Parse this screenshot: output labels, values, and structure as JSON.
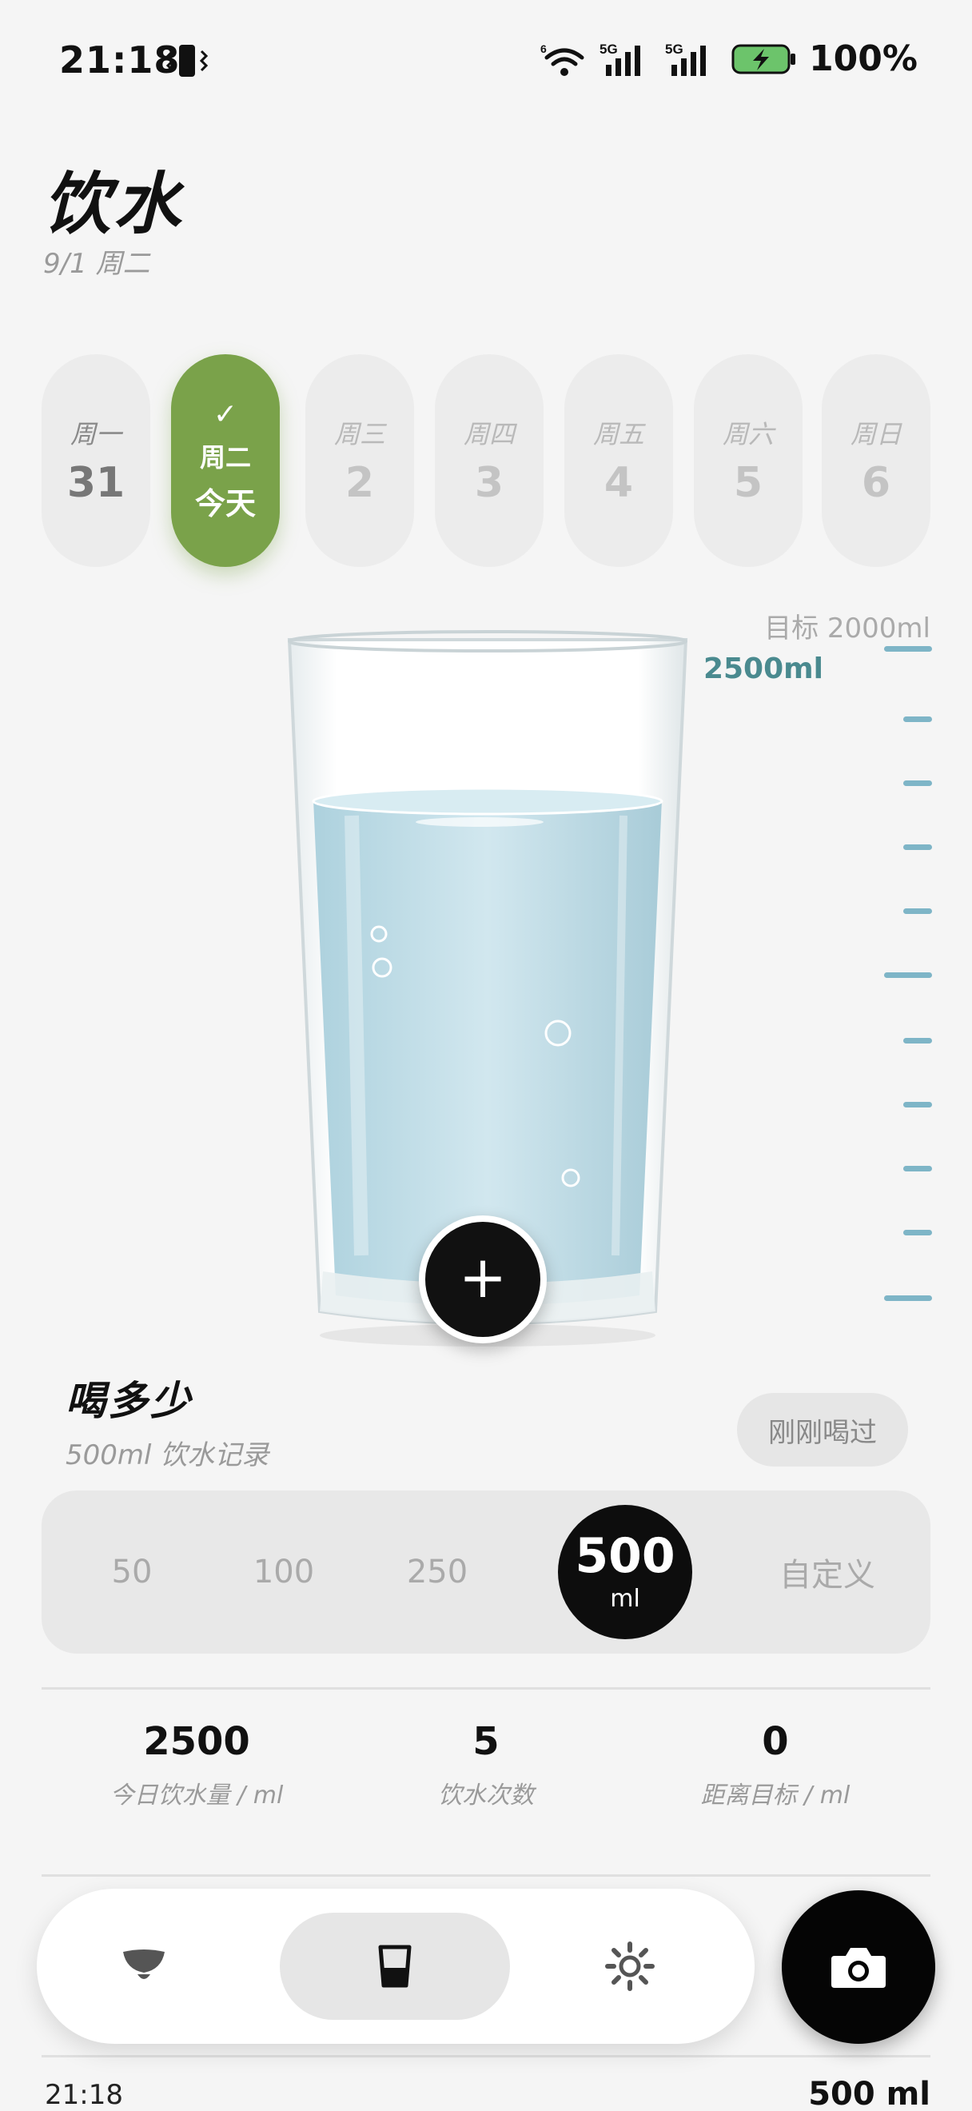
{
  "status_bar": {
    "time": "21:18",
    "signal_1": "5G",
    "signal_2": "5G",
    "wifi_badge": "6",
    "battery": "100%"
  },
  "header": {
    "title": "饮水",
    "date": "9/1 周二"
  },
  "week": [
    {
      "dow": "周一",
      "num": "31",
      "state": "past"
    },
    {
      "dow": "周二",
      "num": "今天",
      "state": "active",
      "check": "✓"
    },
    {
      "dow": "周三",
      "num": "2",
      "state": "future"
    },
    {
      "dow": "周四",
      "num": "3",
      "state": "future"
    },
    {
      "dow": "周五",
      "num": "4",
      "state": "future"
    },
    {
      "dow": "周六",
      "num": "5",
      "state": "future"
    },
    {
      "dow": "周日",
      "num": "6",
      "state": "future"
    }
  ],
  "glass": {
    "goal_label": "目标 2000ml",
    "current_label": "2500ml",
    "fill_fraction": 0.82
  },
  "add_button": {
    "icon": "plus-icon",
    "symbol": "+"
  },
  "amount_section": {
    "title": "喝多少",
    "subtitle": "500ml 饮水记录",
    "just_drank_label": "刚刚喝过",
    "options": [
      "50",
      "100",
      "250"
    ],
    "selected": {
      "value": "500",
      "unit": "ml"
    },
    "custom_label": "自定义"
  },
  "stats": [
    {
      "value": "2500",
      "label": "今日饮水量 / ml"
    },
    {
      "value": "5",
      "label": "饮水次数"
    },
    {
      "value": "0",
      "label": "距离目标 / ml"
    }
  ],
  "records_peek": {
    "time": "21:18",
    "amount": "500 ml"
  },
  "nav": {
    "items": [
      "lamp-icon",
      "cup-icon",
      "sun-icon"
    ],
    "active": "cup-icon",
    "camera": "camera-icon"
  },
  "colors": {
    "accent_green": "#7aa24a",
    "water_blue": "#bcdbe6",
    "teal_text": "#4a8a8f",
    "dark": "#0d0d0d"
  }
}
